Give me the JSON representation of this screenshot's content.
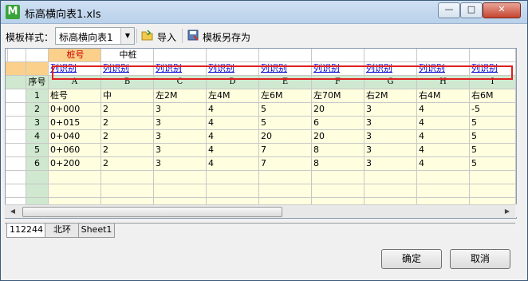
{
  "window": {
    "title": "标高横向表1.xls",
    "app_icon_letter": "M"
  },
  "toolbar": {
    "template_label": "模板样式：",
    "template_value": "标高横向表1",
    "import_label": "导入",
    "save_as_label": "模板另存为"
  },
  "sheet": {
    "top_labels": [
      "桩号",
      "中桩"
    ],
    "recognize_label": "列识别",
    "row_header_label": "序号",
    "columns": [
      "A",
      "B",
      "C",
      "D",
      "E",
      "F",
      "G",
      "H",
      "I"
    ],
    "rows": [
      [
        "1",
        "桩号",
        "中",
        "左2M",
        "左4M",
        "左6M",
        "左70M",
        "右2M",
        "右4M",
        "右6M"
      ],
      [
        "2",
        "0+000",
        "2",
        "3",
        "4",
        "5",
        "20",
        "3",
        "4",
        "-5"
      ],
      [
        "3",
        "0+015",
        "2",
        "3",
        "4",
        "5",
        "6",
        "3",
        "4",
        "5"
      ],
      [
        "4",
        "0+040",
        "2",
        "3",
        "4",
        "20",
        "20",
        "3",
        "4",
        "5"
      ],
      [
        "5",
        "0+060",
        "2",
        "3",
        "4",
        "7",
        "8",
        "3",
        "4",
        "5"
      ],
      [
        "6",
        "0+200",
        "2",
        "3",
        "4",
        "7",
        "8",
        "3",
        "4",
        "5"
      ]
    ]
  },
  "tabs": [
    "112244",
    "北环",
    "Sheet1"
  ],
  "buttons": {
    "ok": "确定",
    "cancel": "取消"
  },
  "colors": {
    "highlight_frame": "#e02020",
    "header_green": "#cfe8cf",
    "cell_yellow": "#ffffe0",
    "link_blue": "#0000cc"
  }
}
